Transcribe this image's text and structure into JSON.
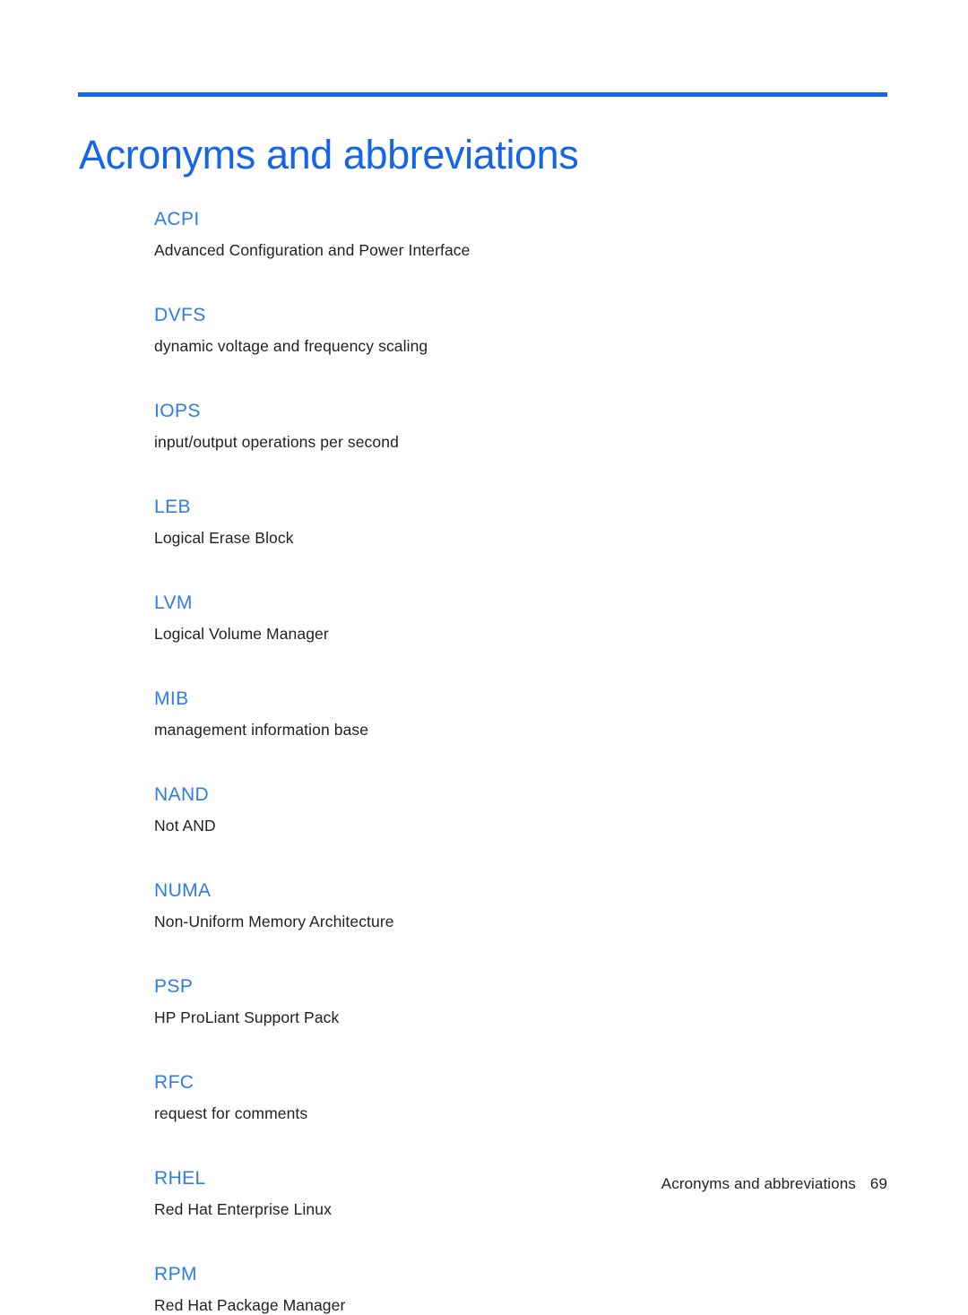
{
  "document": {
    "title": "Acronyms and abbreviations",
    "accent_color": "#1565e8",
    "term_color": "#2e7ce8",
    "text_color": "#231f20",
    "background_color": "#ffffff"
  },
  "glossary": {
    "entries": [
      {
        "term": "ACPI",
        "definition": "Advanced Configuration and Power Interface"
      },
      {
        "term": "DVFS",
        "definition": "dynamic voltage and frequency scaling"
      },
      {
        "term": "IOPS",
        "definition": "input/output operations per second"
      },
      {
        "term": "LEB",
        "definition": "Logical Erase Block"
      },
      {
        "term": "LVM",
        "definition": "Logical Volume Manager"
      },
      {
        "term": "MIB",
        "definition": "management information base"
      },
      {
        "term": "NAND",
        "definition": "Not AND"
      },
      {
        "term": "NUMA",
        "definition": "Non-Uniform Memory Architecture"
      },
      {
        "term": "PSP",
        "definition": "HP ProLiant Support Pack"
      },
      {
        "term": "RFC",
        "definition": "request for comments"
      },
      {
        "term": "RHEL",
        "definition": "Red Hat Enterprise Linux"
      },
      {
        "term": "RPM",
        "definition": "Red Hat Package Manager"
      }
    ]
  },
  "footer": {
    "section_label": "Acronyms and abbreviations",
    "page_number": "69"
  }
}
